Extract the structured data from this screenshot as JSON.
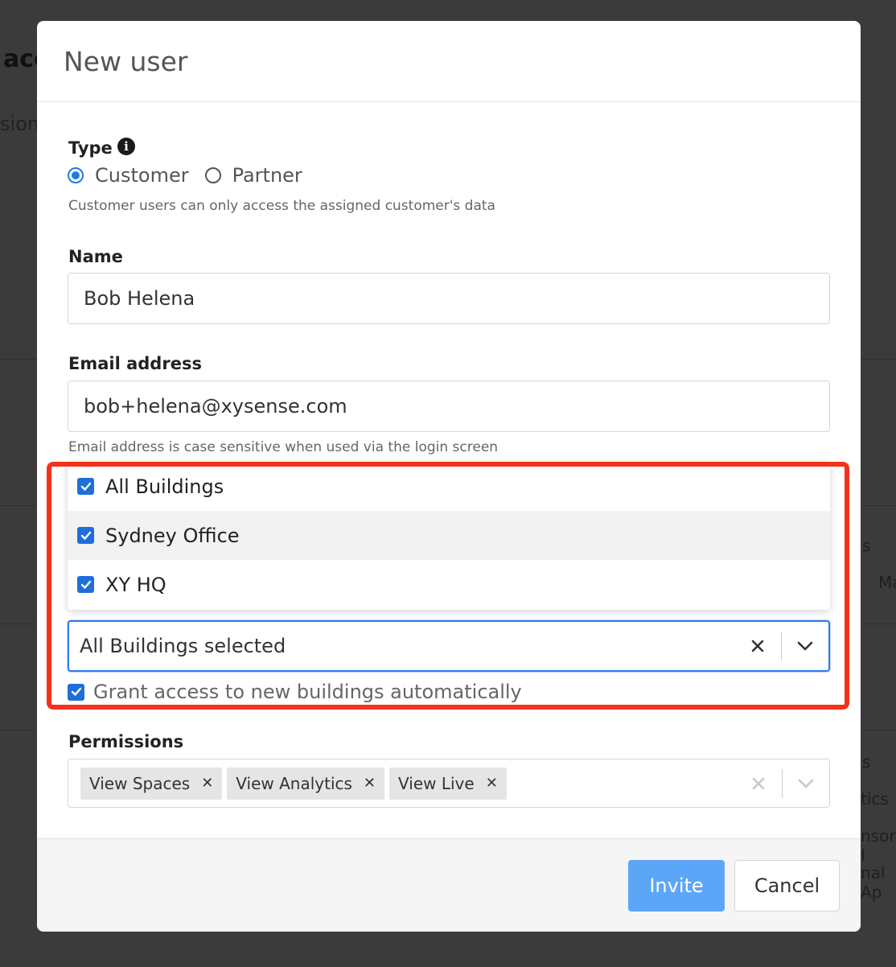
{
  "background": {
    "fragments": [
      "acc",
      "sions",
      "s",
      "Ma",
      "s",
      "tics",
      "nsor I",
      "nal Ap"
    ]
  },
  "modal": {
    "title": "New user"
  },
  "type_field": {
    "label": "Type",
    "options": [
      {
        "label": "Customer",
        "checked": true
      },
      {
        "label": "Partner",
        "checked": false
      }
    ],
    "help": "Customer users can only access the assigned customer's data"
  },
  "name_field": {
    "label": "Name",
    "value": "Bob Helena"
  },
  "email_field": {
    "label": "Email address",
    "value": "bob+helena@xysense.com",
    "help": "Email address is case sensitive when used via the login screen"
  },
  "buildings": {
    "menu_options": [
      {
        "label": "All Buildings",
        "checked": true
      },
      {
        "label": "Sydney Office",
        "checked": true
      },
      {
        "label": "XY HQ",
        "checked": true
      }
    ],
    "selected_value": "All Buildings selected",
    "auto_grant_label": "Grant access to new buildings automatically",
    "auto_grant_checked": true
  },
  "permissions": {
    "label": "Permissions",
    "tags": [
      "View Spaces",
      "View Analytics",
      "View Live"
    ]
  },
  "footer": {
    "invite_label": "Invite",
    "cancel_label": "Cancel"
  },
  "colors": {
    "accent": "#1e7be6",
    "primary_button": "#5ca6f7",
    "highlight": "#f4321c"
  }
}
